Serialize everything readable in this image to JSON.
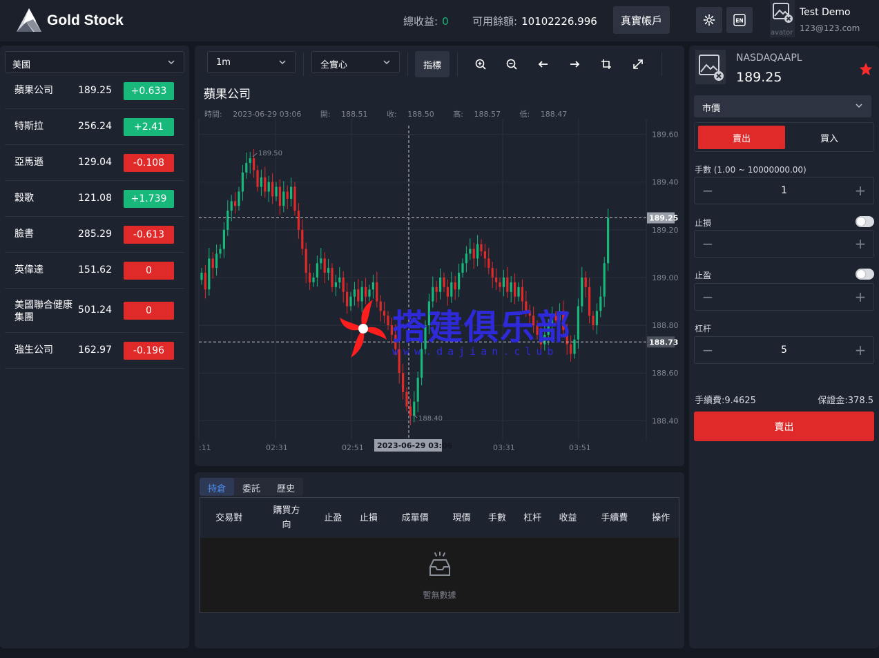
{
  "header": {
    "brand": "Gold Stock",
    "total_profit_label": "總收益:",
    "total_profit_value": "0",
    "available_balance_label": "可用餘額:",
    "available_balance_value": "10102226.996",
    "real_account_button": "真實帳戶",
    "settings_icon": "gear-icon",
    "language_icon": "EN",
    "avatar_alt": "avator",
    "user_name": "Test Demo",
    "user_email": "123@123.com"
  },
  "watchlist": {
    "market": "美國",
    "stocks": [
      {
        "name": "蘋果公司",
        "price": "189.25",
        "change": "+0.633",
        "dir": "up"
      },
      {
        "name": "特斯拉",
        "price": "256.24",
        "change": "+2.41",
        "dir": "up"
      },
      {
        "name": "亞馬遜",
        "price": "129.04",
        "change": "-0.108",
        "dir": "down"
      },
      {
        "name": "穀歌",
        "price": "121.08",
        "change": "+1.739",
        "dir": "up"
      },
      {
        "name": "臉書",
        "price": "285.29",
        "change": "-0.613",
        "dir": "down"
      },
      {
        "name": "英偉達",
        "price": "151.62",
        "change": "0",
        "dir": "down"
      },
      {
        "name": "美國聯合健康集團",
        "price": "501.24",
        "change": "0",
        "dir": "down"
      },
      {
        "name": "強生公司",
        "price": "162.97",
        "change": "-0.196",
        "dir": "down"
      }
    ]
  },
  "chart_toolbar": {
    "interval": "1m",
    "crosshair_mode": "全實心",
    "indicators_button": "指標",
    "tools": [
      "zoom-in-icon",
      "zoom-out-icon",
      "arrow-left-icon",
      "arrow-right-icon",
      "crop-icon",
      "fullscreen-icon"
    ]
  },
  "chart_header": {
    "title": "蘋果公司",
    "ohlc": {
      "time_label": "時間:",
      "time": "2023-06-29 03:06",
      "open_label": "開:",
      "open": "188.51",
      "close_label": "收:",
      "close": "188.50",
      "high_label": "高:",
      "high": "188.57",
      "low_label": "低:",
      "low": "188.47"
    }
  },
  "chart_data": {
    "type": "candlestick",
    "title": "蘋果公司",
    "ylim": [
      188.32,
      189.7
    ],
    "y_ticks": [
      "189.60",
      "189.40",
      "189.20",
      "189.00",
      "188.80",
      "188.60",
      "188.40"
    ],
    "x_ticks": [
      ":11",
      "02:31",
      "02:51",
      "03:31",
      "03:51"
    ],
    "crosshair_x_label": "2023-06-29 03:06",
    "current_price_label": "189.25",
    "crosshair_price_label": "188.73",
    "max_label": "189.50",
    "min_label": "188.40",
    "closes": [
      189.02,
      188.95,
      189.08,
      189.04,
      189.1,
      189.12,
      189.2,
      189.28,
      189.32,
      189.3,
      189.36,
      189.44,
      189.48,
      189.5,
      189.45,
      189.38,
      189.42,
      189.36,
      189.4,
      189.34,
      189.38,
      189.3,
      189.36,
      189.33,
      189.38,
      189.28,
      189.2,
      189.12,
      189.02,
      188.98,
      189.0,
      189.06,
      189.08,
      189.02,
      189.04,
      188.96,
      188.98,
      189.0,
      188.94,
      188.88,
      188.92,
      188.95,
      188.9,
      188.96,
      188.92,
      188.95,
      188.98,
      188.9,
      188.86,
      188.84,
      188.8,
      188.76,
      188.7,
      188.6,
      188.52,
      188.46,
      188.42,
      188.48,
      188.58,
      188.7,
      188.8,
      188.9,
      188.96,
      188.94,
      189.0,
      188.96,
      188.92,
      188.98,
      188.95,
      189.02,
      189.06,
      189.1,
      189.12,
      189.08,
      189.14,
      189.11,
      189.08,
      189.04,
      189.0,
      188.98,
      188.96,
      189.0,
      188.94,
      188.98,
      188.92,
      188.96,
      188.9,
      188.86,
      188.84,
      188.8,
      188.76,
      188.72,
      188.76,
      188.8,
      188.84,
      188.82,
      188.86,
      188.78,
      188.72,
      188.68,
      188.74,
      188.88,
      189.0,
      188.96,
      188.84,
      188.8,
      188.86,
      188.92,
      189.06,
      189.25
    ],
    "up_color": "#17b87a",
    "down_color": "#e02a2a"
  },
  "orders": {
    "tabs": [
      "持倉",
      "委託",
      "歷史"
    ],
    "columns": [
      "交易對",
      "購買方向",
      "止盈",
      "止損",
      "成單價",
      "現價",
      "手數",
      "杠杆",
      "收益",
      "手續費",
      "操作"
    ],
    "empty_text": "暫無數據"
  },
  "trade": {
    "symbol": "NASDAQAAPL",
    "price": "189.25",
    "favorite_icon": "star-icon",
    "order_type": "市價",
    "sell_tab": "賣出",
    "buy_tab": "買入",
    "lots_label": "手數 (1.00 ~ 10000000.00)",
    "lots_value": "1",
    "stop_loss_label": "止損",
    "take_profit_label": "止盈",
    "leverage_label": "杠杆",
    "leverage_value": "5",
    "fee_label": "手續費:9.4625",
    "margin_label": "保證金:378.5",
    "submit_button": "賣出"
  },
  "watermark": {
    "text": "搭建俱乐部",
    "url": "www.dajian.club"
  }
}
